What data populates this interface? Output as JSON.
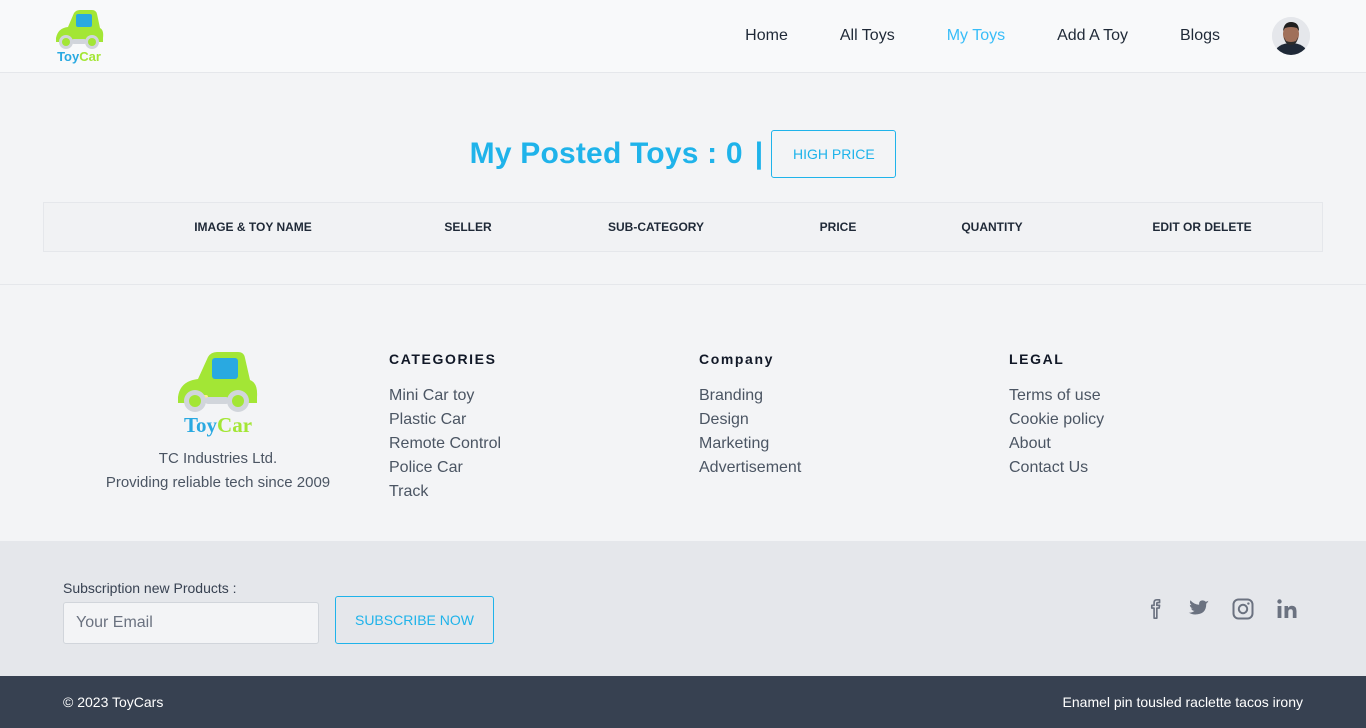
{
  "brand": {
    "logo_text": "ToyCar"
  },
  "nav": {
    "links": [
      {
        "label": "Home",
        "active": false
      },
      {
        "label": "All Toys",
        "active": false
      },
      {
        "label": "My Toys",
        "active": true
      },
      {
        "label": "Add A Toy",
        "active": false
      },
      {
        "label": "Blogs",
        "active": false
      }
    ]
  },
  "main": {
    "title": "My Posted Toys : 0",
    "separator": "|",
    "sort_button": "HIGH PRICE",
    "table": {
      "columns": [
        "IMAGE & TOY NAME",
        "SELLER",
        "SUB-CATEGORY",
        "PRICE",
        "QUANTITY",
        "EDIT OR DELETE"
      ],
      "rows": []
    }
  },
  "footer": {
    "company_name": "TC Industries Ltd.",
    "tagline": "Providing reliable tech since 2009",
    "columns": [
      {
        "heading": "CATEGORIES",
        "links": [
          "Mini Car toy",
          "Plastic Car",
          "Remote Control",
          "Police Car",
          "Track"
        ]
      },
      {
        "heading": "Company",
        "links": [
          "Branding",
          "Design",
          "Marketing",
          "Advertisement"
        ]
      },
      {
        "heading": "LEGAL",
        "links": [
          "Terms of use",
          "Cookie policy",
          "About",
          "Contact Us"
        ]
      }
    ]
  },
  "subscribe": {
    "label": "Subscription new Products :",
    "placeholder": "Your Email",
    "button": "SUBSCRIBE NOW"
  },
  "socials": [
    "facebook-icon",
    "twitter-icon",
    "instagram-icon",
    "linkedin-icon"
  ],
  "bottom": {
    "copyright": "© 2023 ToyCars",
    "tagline": "Enamel pin tousled raclette tacos irony"
  },
  "colors": {
    "accent": "#1fb3ea",
    "logo_green": "#a3e635",
    "logo_blue": "#29a9e1",
    "bottom_bar": "#374151"
  }
}
